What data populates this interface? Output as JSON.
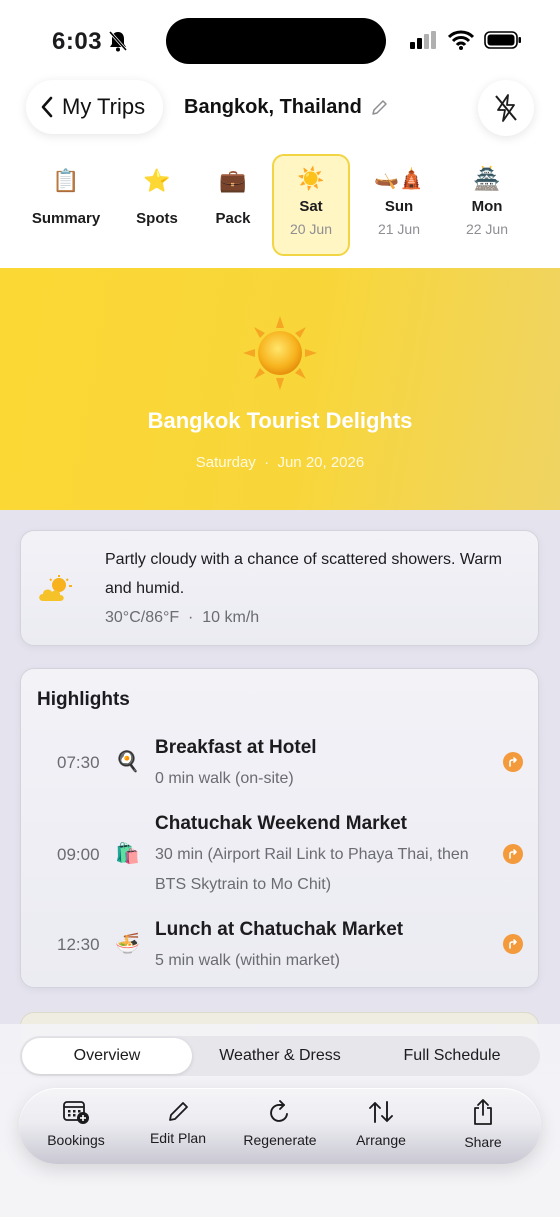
{
  "status_bar": {
    "time": "6:03"
  },
  "nav": {
    "back_label": "My Trips",
    "title": "Bangkok, Thailand"
  },
  "tabs": [
    {
      "emoji": "📋",
      "label": "Summary"
    },
    {
      "emoji": "⭐",
      "label": "Spots"
    },
    {
      "emoji": "💼",
      "label": "Pack"
    },
    {
      "emoji": "☀️",
      "label": "Sat",
      "date": "20 Jun",
      "selected": true
    },
    {
      "emoji": "🛶🛕",
      "label": "Sun",
      "date": "21 Jun"
    },
    {
      "emoji": "🏯",
      "label": "Mon",
      "date": "22 Jun"
    }
  ],
  "hero": {
    "title": "Bangkok Tourist Delights",
    "date_line": "Saturday  ·  Jun 20, 2026"
  },
  "weather": {
    "description": "Partly cloudy with a chance of scattered showers. Warm and humid.",
    "meta": "30°C/86°F  ·  10 km/h"
  },
  "highlights": {
    "title": "Highlights",
    "items": [
      {
        "time": "07:30",
        "emoji": "🍳",
        "name": "Breakfast at Hotel",
        "desc": "0 min walk (on-site)"
      },
      {
        "time": "09:00",
        "emoji": "🛍️",
        "name": "Chatuchak Weekend Market",
        "desc": "30 min (Airport Rail Link to Phaya Thai, then BTS Skytrain to Mo Chit)"
      },
      {
        "time": "12:30",
        "emoji": "🍜",
        "name": "Lunch at Chatuchak Market",
        "desc": "5 min walk (within market)"
      }
    ]
  },
  "segments": [
    {
      "label": "Overview",
      "active": true
    },
    {
      "label": "Weather & Dress"
    },
    {
      "label": "Full Schedule"
    }
  ],
  "toolbar": [
    {
      "icon": "calendar-plus-icon",
      "label": "Bookings"
    },
    {
      "icon": "pencil-icon",
      "label": "Edit Plan"
    },
    {
      "icon": "refresh-icon",
      "label": "Regenerate"
    },
    {
      "icon": "arrows-updown-icon",
      "label": "Arrange"
    },
    {
      "icon": "share-icon",
      "label": "Share"
    }
  ]
}
